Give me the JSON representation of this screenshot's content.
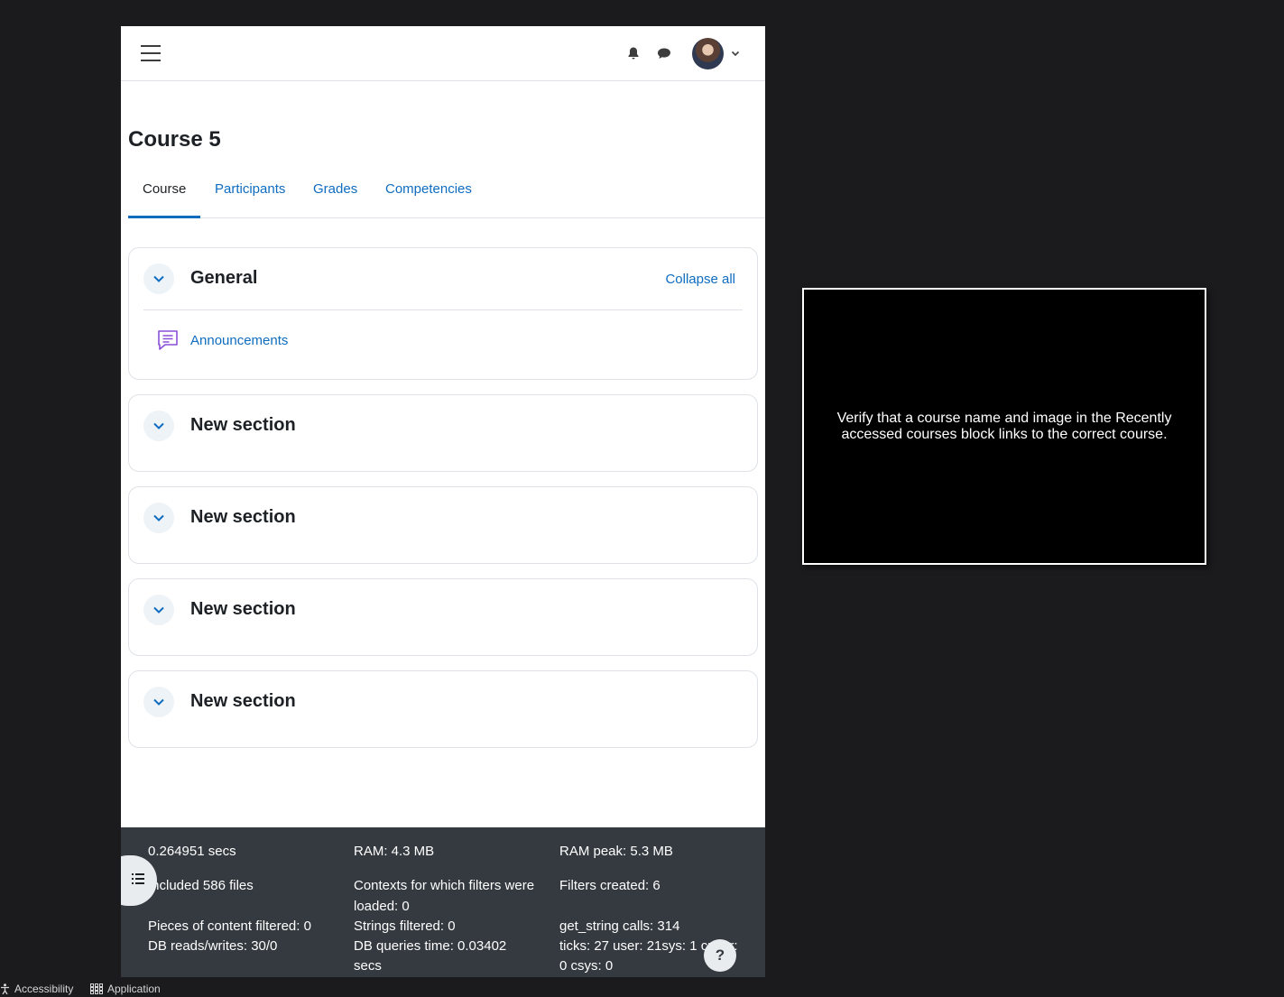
{
  "header": {
    "menu_icon": "hamburger-icon",
    "notifications_icon": "bell-icon",
    "messages_icon": "chat-bubble-icon",
    "user_menu_icon": "chevron-down-icon"
  },
  "page": {
    "title": "Course 5"
  },
  "tabs": [
    {
      "label": "Course",
      "active": true
    },
    {
      "label": "Participants"
    },
    {
      "label": "Grades"
    },
    {
      "label": "Competencies"
    }
  ],
  "sections": [
    {
      "title": "General",
      "collapse_all_label": "Collapse all",
      "activities": [
        {
          "label": "Announcements",
          "icon": "forum-icon"
        }
      ]
    },
    {
      "title": "New section"
    },
    {
      "title": "New section"
    },
    {
      "title": "New section"
    },
    {
      "title": "New section"
    }
  ],
  "footer": {
    "time": "0.264951 secs",
    "ram": "RAM: 4.3 MB",
    "ram_peak": "RAM peak: 5.3 MB",
    "included_files": "Included 586 files",
    "contexts_line1": "Contexts for which filters were",
    "contexts_line2": "loaded: 0",
    "filters_created": "Filters created: 6",
    "pieces_filtered": "Pieces of content filtered: 0",
    "strings_filtered": "Strings filtered: 0",
    "get_string_calls": "get_string calls: 314",
    "db_reads_writes": "DB reads/writes: 30/0",
    "db_queries_time_line1": "DB queries time: 0.03402",
    "db_queries_time_line2": "secs",
    "ticks": "ticks: 27 user: 21sys: 1 cuser:",
    "csys": "0 csys: 0",
    "help_label": "?"
  },
  "overlay": {
    "text": "Verify that a course name and image in the Recently accessed courses block links to the correct course."
  },
  "taskbar": {
    "accessibility": "Accessibility",
    "application": "Application"
  },
  "colors": {
    "link": "#0f6cbf",
    "footer_bg": "#343a40",
    "desktop_bg": "#1b1b1d"
  }
}
